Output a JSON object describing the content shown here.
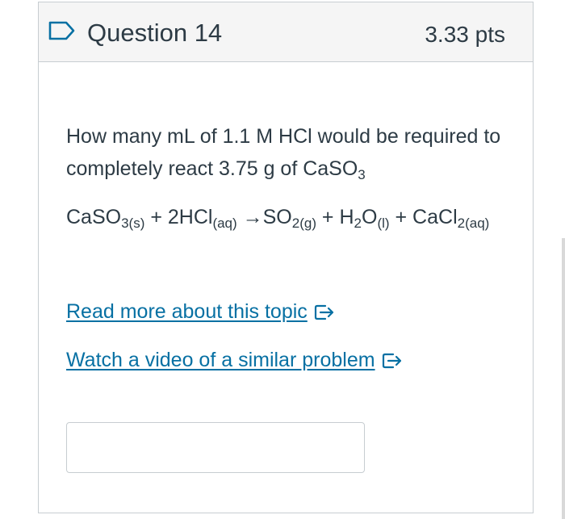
{
  "question": {
    "title": "Question 14",
    "points": "3.33 pts",
    "text": "How many mL of 1.1 M HCl would be required to completely react 3.75 g of CaSO",
    "text_subscript": "3",
    "equation": {
      "r1": "CaSO",
      "r1_sub": "3(s)",
      "plus1": " + 2HCl",
      "r2_sub": "(aq)",
      "arrow": " →SO",
      "p1_sub": "2(g)",
      "plus2": " + H",
      "p2_sub": "2",
      "p2b": "O",
      "p2b_sub": "(l)",
      "plus3": " + CaCl",
      "p3_sub": "2(aq)"
    }
  },
  "links": {
    "read_more": "Read more about this topic",
    "watch_video": "Watch a video of a similar problem"
  },
  "answer": {
    "value": "",
    "placeholder": ""
  },
  "icons": {
    "flag": "bookmark-flag-icon",
    "external": "external-link-icon"
  },
  "colors": {
    "link": "#0770a3",
    "text": "#2d3b45",
    "header_bg": "#f5f5f5",
    "border": "#c7cdd1",
    "flag": "#0770a3"
  }
}
